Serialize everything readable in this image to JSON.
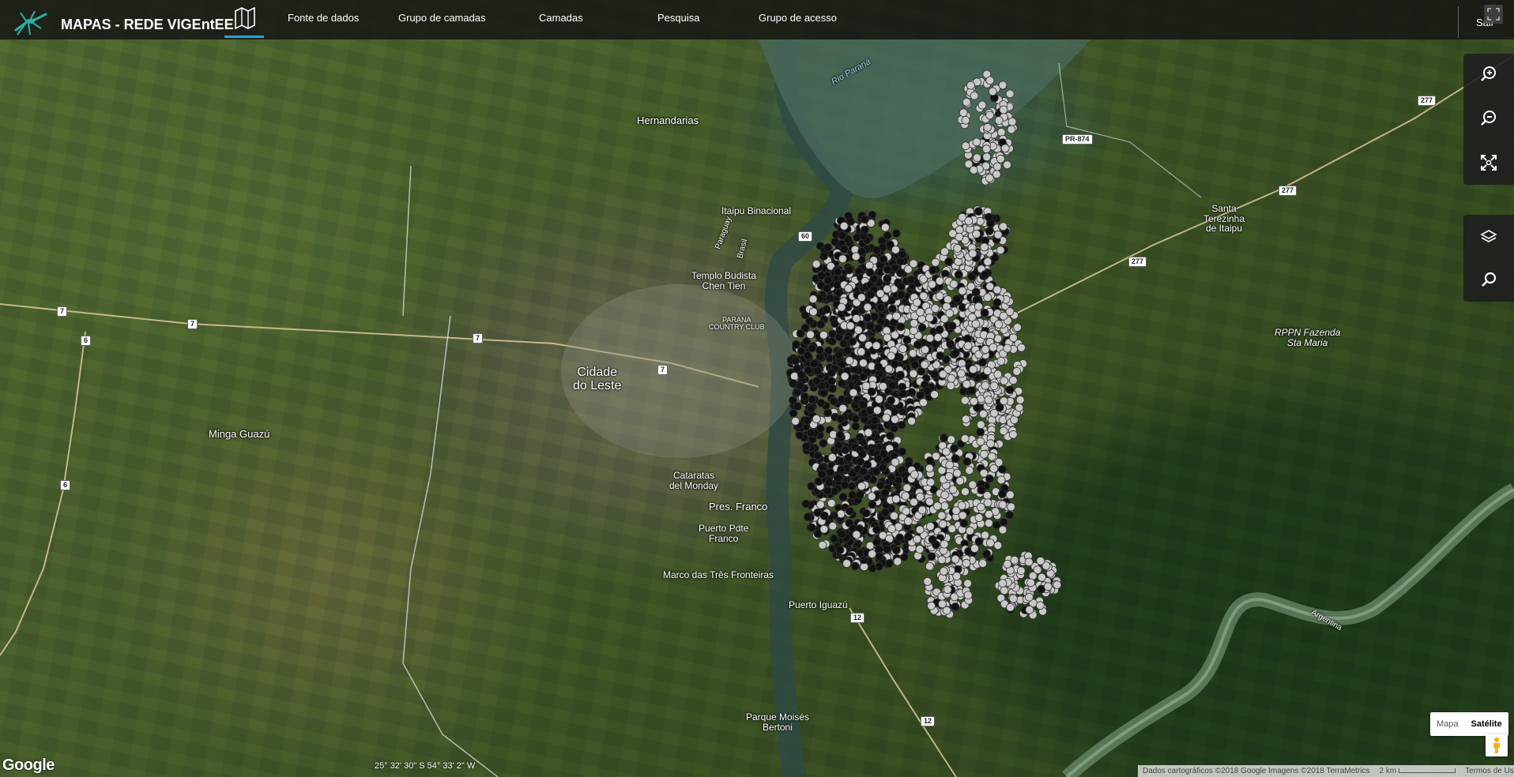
{
  "header": {
    "app_title": "MAPAS - REDE VIGEntEE",
    "logo_icon": "mosquito-logo-icon",
    "maps_tab_icon": "map-icon",
    "nav": [
      "Fonte de dados",
      "Grupo de camadas",
      "Camadas",
      "Pesquisa",
      "Grupo de acesso"
    ],
    "logout": "Sair",
    "accent_color": "#29a3d6"
  },
  "toolbar": {
    "zoom_in_icon": "zoom-in-icon",
    "zoom_out_icon": "zoom-out-icon",
    "fit_extent_icon": "fit-extent-icon",
    "layers_icon": "layers-icon",
    "search_icon": "search-icon"
  },
  "map": {
    "places": {
      "hernandarias": "Hernandarias",
      "itaipu": "Itaipu Binacional",
      "templo": "Templo Budista\nChen Tien",
      "parana_club": "PARANA\nCOUNTRY CLUB",
      "cidade": "Cidade\ndo Leste",
      "minga": "Minga Guazú",
      "cataratas": "Cataratas\ndel Monday",
      "pres_franco": "Pres. Franco",
      "puerto_pdte": "Puerto Pdte\nFranco",
      "marco": "Marco das Três Fronteiras",
      "puerto_iguazu": "Puerto Iguazú",
      "parque": "Parque Moisés\nBertoni",
      "santa_terezinha": "Santa\nTerezinha\nde Itaipu",
      "rppn": "RPPN Fazenda\nSta Maria",
      "rio_parana": "Rio Paraná",
      "paraguay": "Paraguay",
      "brasil": "Brasil",
      "argentina": "Argentina",
      "pr874": "PR-874"
    },
    "road_shields": [
      "7",
      "6",
      "60",
      "12",
      "277"
    ],
    "point_fill_color": "#c8c8c8",
    "point_dark_color": "#111111"
  },
  "map_type": {
    "options": [
      "Mapa",
      "Satélite"
    ],
    "selected": "Satélite",
    "pegman_icon": "pegman-icon"
  },
  "footer": {
    "google_logo": "Google",
    "coords": "25° 32' 30\" S 54° 33' 2\" W",
    "attribution": "Dados cartográficos ©2018 Google Imagens ©2018 TerraMetrics",
    "scale": "2 km",
    "terms": "Termos de Uso"
  }
}
